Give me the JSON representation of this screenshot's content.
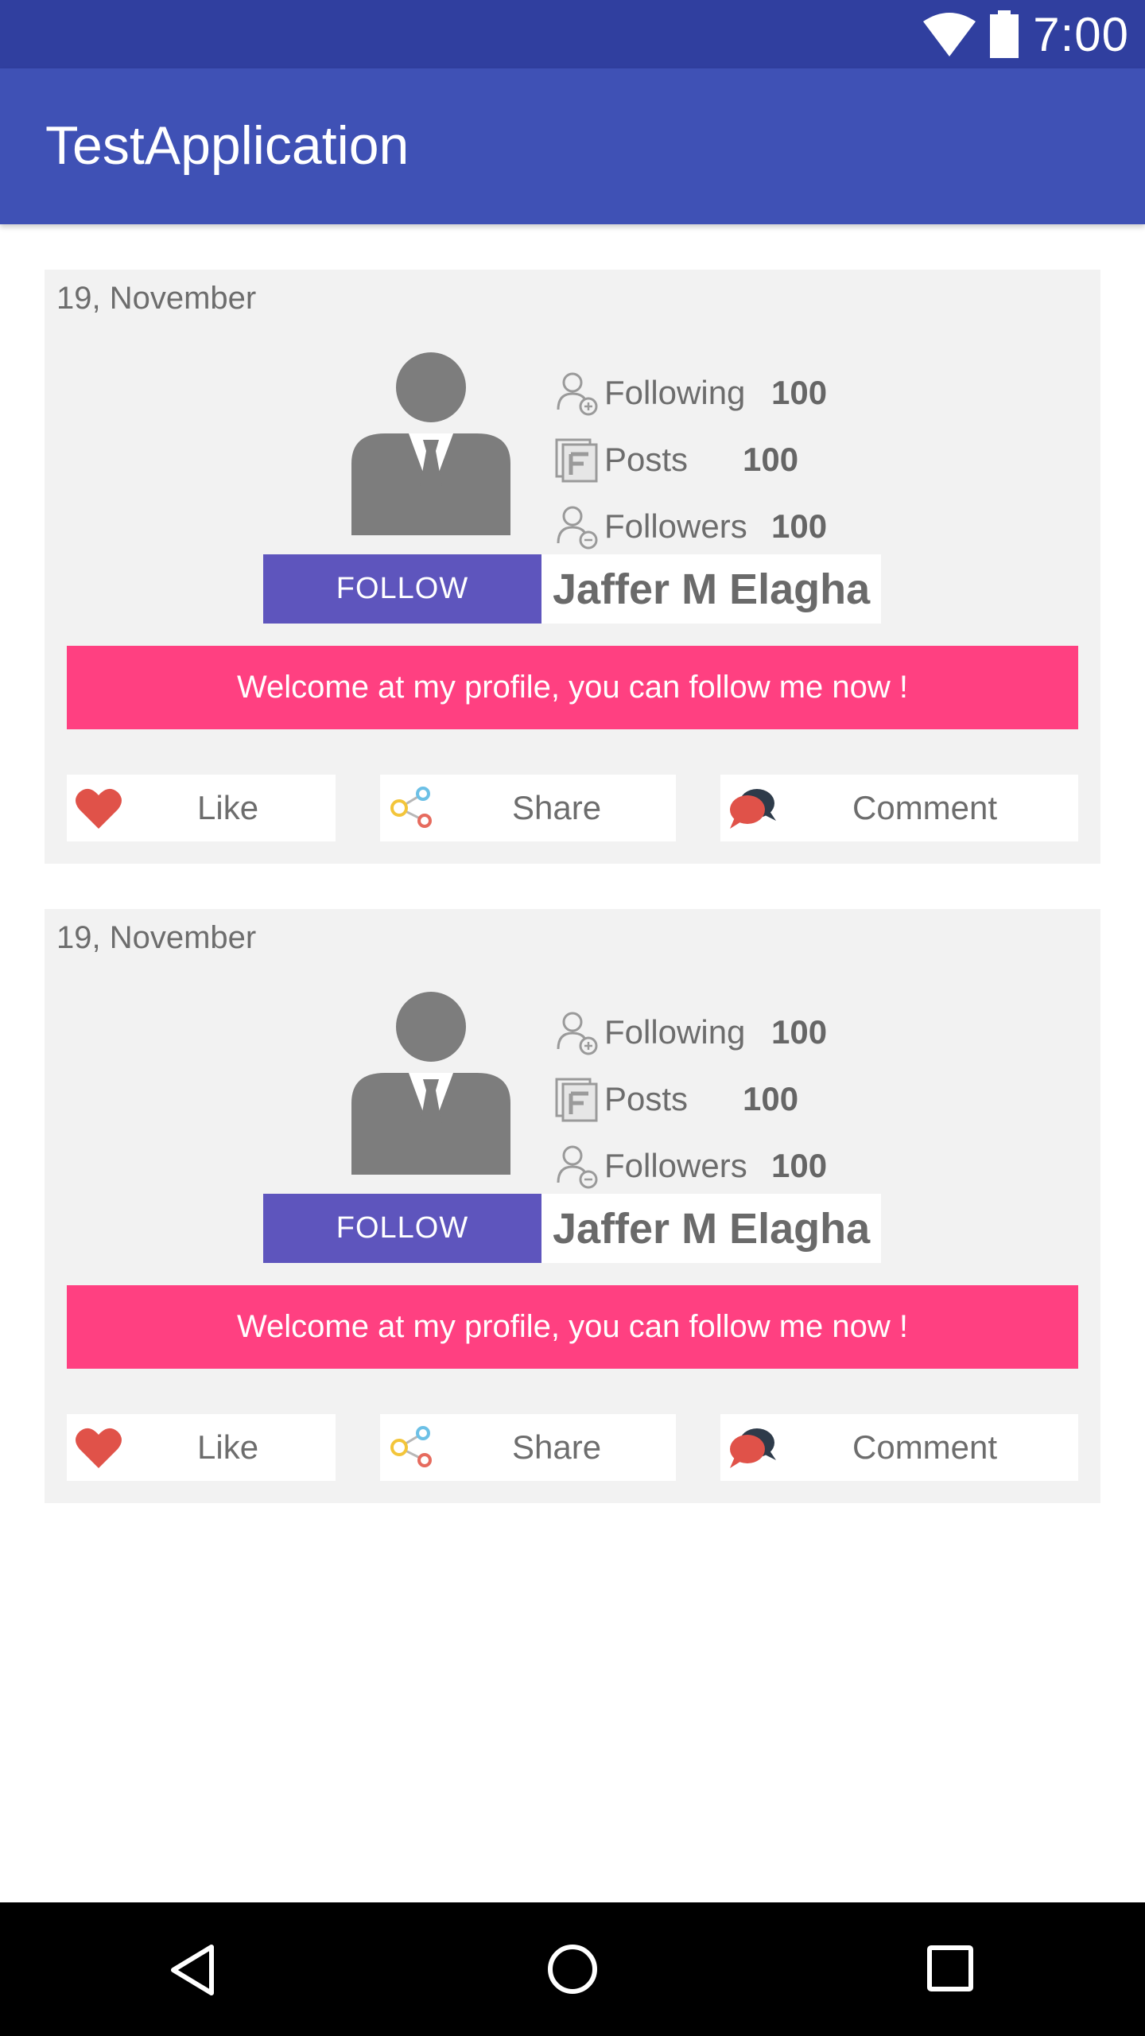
{
  "status_bar": {
    "time": "7:00",
    "icons": [
      "wifi-icon",
      "battery-icon"
    ]
  },
  "app_bar": {
    "title": "TestApplication",
    "color": "#3f51b5"
  },
  "posts": [
    {
      "date": "19, November",
      "stats": [
        {
          "icon": "following-icon",
          "label": "Following",
          "value": "100"
        },
        {
          "icon": "posts-icon",
          "label": "Posts",
          "value": "100"
        },
        {
          "icon": "followers-icon",
          "label": "Followers",
          "value": "100"
        }
      ],
      "follow_label": "FOLLOW",
      "name": "Jaffer M Elagha",
      "welcome": "Welcome at my profile, you can follow me now !",
      "actions": [
        {
          "icon": "heart-icon",
          "label": "Like"
        },
        {
          "icon": "share-icon",
          "label": "Share"
        },
        {
          "icon": "comment-icon",
          "label": "Comment"
        }
      ]
    },
    {
      "date": "19, November",
      "stats": [
        {
          "icon": "following-icon",
          "label": "Following",
          "value": "100"
        },
        {
          "icon": "posts-icon",
          "label": "Posts",
          "value": "100"
        },
        {
          "icon": "followers-icon",
          "label": "Followers",
          "value": "100"
        }
      ],
      "follow_label": "FOLLOW",
      "name": "Jaffer M Elagha",
      "welcome": "Welcome at my profile, you can follow me now !",
      "actions": [
        {
          "icon": "heart-icon",
          "label": "Like"
        },
        {
          "icon": "share-icon",
          "label": "Share"
        },
        {
          "icon": "comment-icon",
          "label": "Comment"
        }
      ]
    }
  ],
  "nav_bar": {
    "buttons": [
      "back-icon",
      "home-icon",
      "recents-icon"
    ]
  },
  "colors": {
    "status_bar": "#303f9f",
    "follow_button": "#5e55bd",
    "welcome_banner": "#ff4081",
    "card_background": "#f2f2f2"
  }
}
